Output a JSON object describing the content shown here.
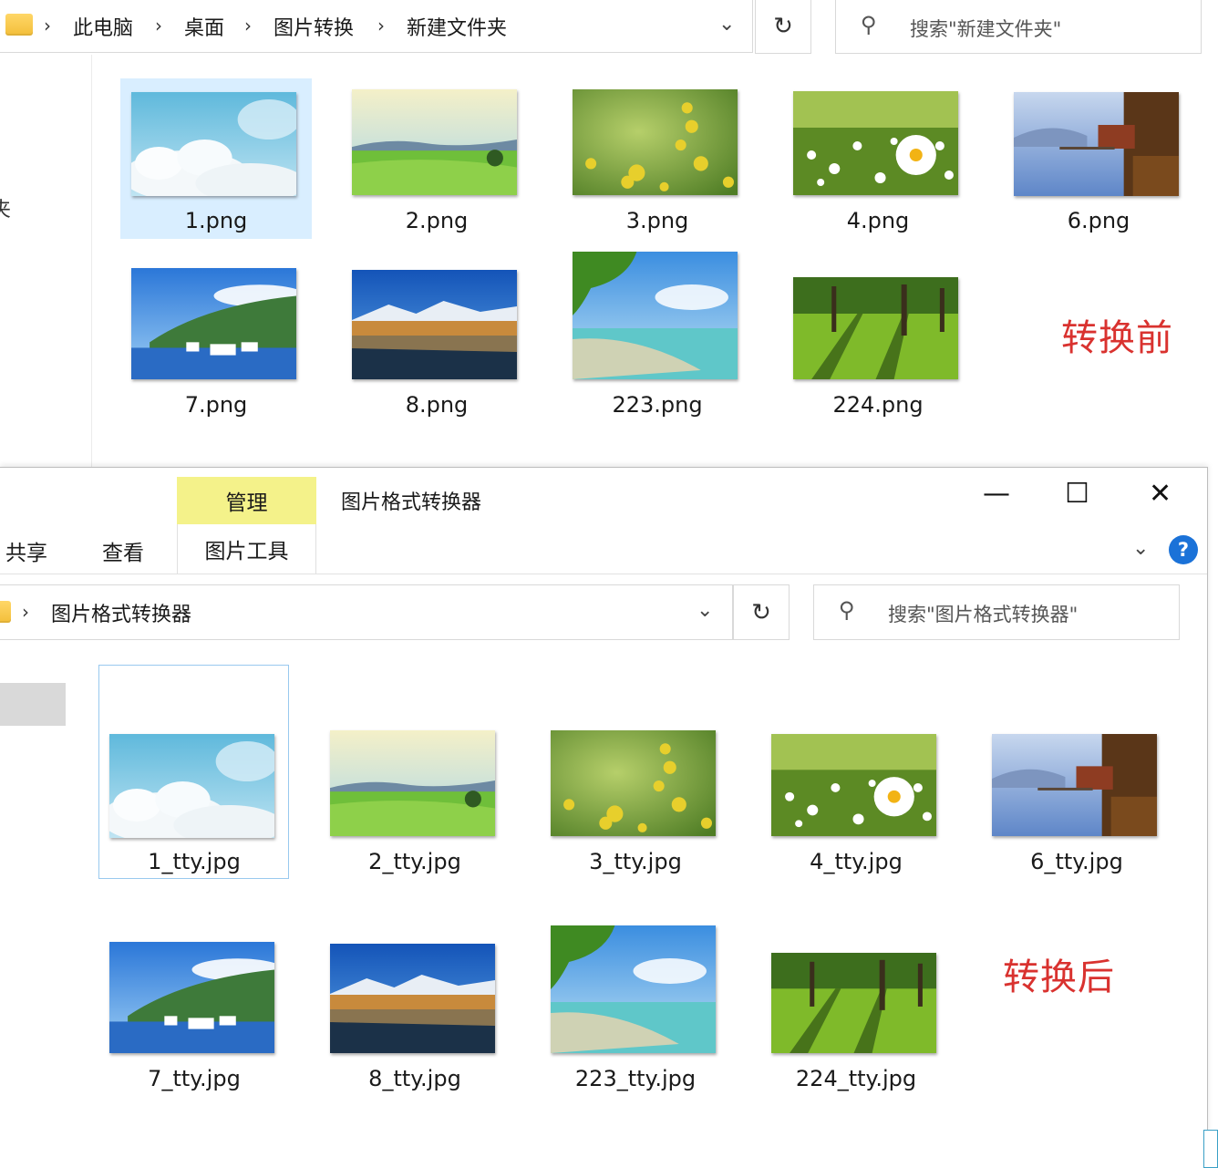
{
  "top_window": {
    "breadcrumb": [
      "此电脑",
      "桌面",
      "图片转换",
      "新建文件夹"
    ],
    "search_placeholder": "搜索\"新建文件夹\"",
    "left_pane_fragment": "夹",
    "files": [
      {
        "name": "1.png",
        "scene": "clouds"
      },
      {
        "name": "2.png",
        "scene": "meadow"
      },
      {
        "name": "3.png",
        "scene": "yellow-flowers"
      },
      {
        "name": "4.png",
        "scene": "daisies"
      },
      {
        "name": "6.png",
        "scene": "lake-house"
      },
      {
        "name": "7.png",
        "scene": "harbor"
      },
      {
        "name": "8.png",
        "scene": "mountain-town"
      },
      {
        "name": "223.png",
        "scene": "beach"
      },
      {
        "name": "224.png",
        "scene": "park"
      }
    ],
    "annotation": "转换前"
  },
  "bottom_window": {
    "title": "图片格式转换器",
    "ribbon": {
      "share_tab": "共享",
      "view_tab": "查看",
      "manage_tab": "管理",
      "picture_tools_tab": "图片工具"
    },
    "breadcrumb": [
      "图片格式转换器"
    ],
    "search_placeholder": "搜索\"图片格式转换器\"",
    "window_controls": {
      "minimize": "—",
      "maximize": "☐",
      "close": "✕"
    },
    "help": "?",
    "files": [
      {
        "name": "1_tty.jpg",
        "scene": "clouds"
      },
      {
        "name": "2_tty.jpg",
        "scene": "meadow"
      },
      {
        "name": "3_tty.jpg",
        "scene": "yellow-flowers"
      },
      {
        "name": "4_tty.jpg",
        "scene": "daisies"
      },
      {
        "name": "6_tty.jpg",
        "scene": "lake-house"
      },
      {
        "name": "7_tty.jpg",
        "scene": "harbor"
      },
      {
        "name": "8_tty.jpg",
        "scene": "mountain-town"
      },
      {
        "name": "223_tty.jpg",
        "scene": "beach"
      },
      {
        "name": "224_tty.jpg",
        "scene": "park"
      }
    ],
    "annotation": "转换后"
  },
  "icons": {
    "breadcrumb_separator": "chevron-right-icon",
    "dropdown": "chevron-down-icon",
    "refresh": "refresh-icon",
    "search": "search-icon",
    "folder": "folder-icon",
    "help": "help-icon"
  },
  "colors": {
    "annotation_red": "#d9322f",
    "manage_tab_yellow": "#f4f28a",
    "selection_blue": "#cce8ff",
    "help_blue": "#1b72d8"
  }
}
